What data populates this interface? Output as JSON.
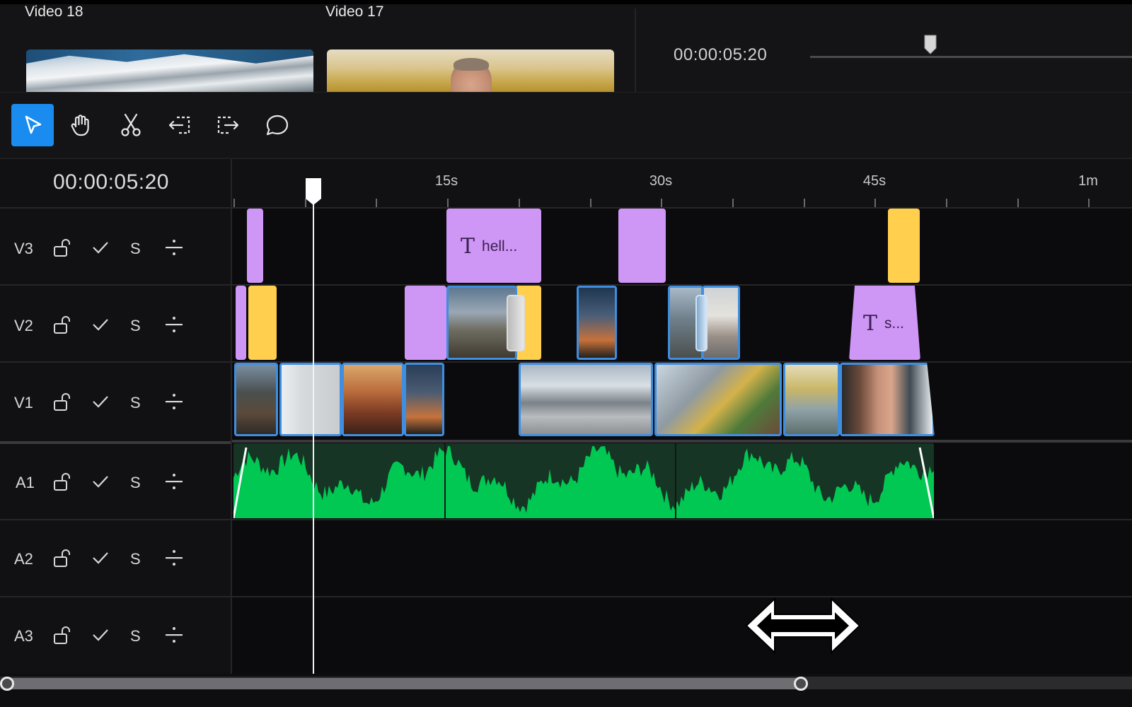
{
  "media": [
    {
      "title": "Video 18"
    },
    {
      "title": "Video 17"
    }
  ],
  "preview": {
    "timecode": "00:00:05:20"
  },
  "toolbar": {
    "tools": [
      {
        "icon": "cursor-icon",
        "active": true
      },
      {
        "icon": "hand-icon",
        "active": false
      },
      {
        "icon": "scissors-icon",
        "active": false
      },
      {
        "icon": "trim-start-icon",
        "active": false
      },
      {
        "icon": "trim-end-icon",
        "active": false
      },
      {
        "icon": "comment-icon",
        "active": false
      }
    ]
  },
  "timeline": {
    "timecode": "00:00:05:20",
    "ruler_labels": [
      "15s",
      "30s",
      "45s",
      "1m"
    ],
    "tracks": [
      {
        "name": "V3",
        "solo_label": "S"
      },
      {
        "name": "V2",
        "solo_label": "S"
      },
      {
        "name": "V1",
        "solo_label": "S"
      },
      {
        "name": "A1",
        "solo_label": "S"
      },
      {
        "name": "A2",
        "solo_label": "S"
      },
      {
        "name": "A3",
        "solo_label": "S"
      }
    ],
    "text_clips": [
      {
        "track": "V3",
        "label": "hell..."
      },
      {
        "track": "V2",
        "label": "s..."
      }
    ]
  },
  "colors": {
    "accent": "#1a8cf0",
    "text_clip": "#cf97f5",
    "effect_clip": "#ffcf4d",
    "video_clip_border": "#3f8ee0",
    "audio_wave": "#00c853"
  }
}
